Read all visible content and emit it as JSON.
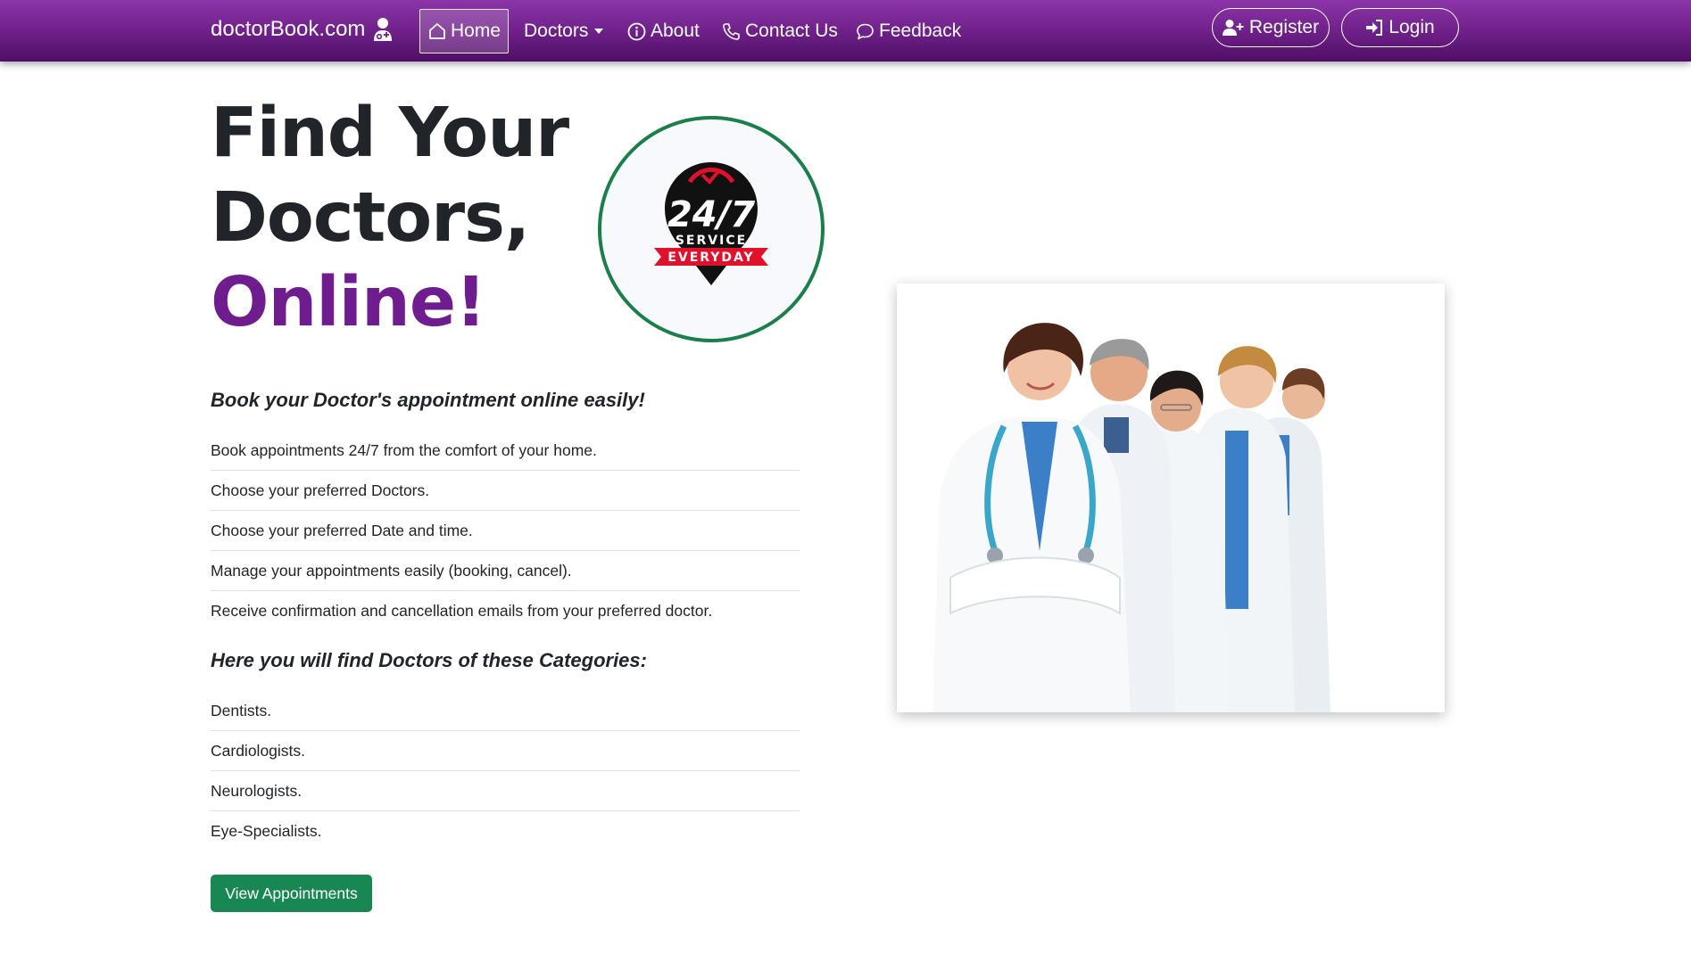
{
  "navbar": {
    "brand": "doctorBook.com",
    "brand_icon": "doctor-icon",
    "items": [
      {
        "label": "Home",
        "icon": "house-icon",
        "active": true
      },
      {
        "label": "Doctors",
        "icon": "caret-down-icon"
      },
      {
        "label": "About",
        "icon": "info-circle-icon"
      },
      {
        "label": "Contact Us",
        "icon": "phone-icon"
      },
      {
        "label": "Feedback",
        "icon": "chat-bubble-icon"
      }
    ],
    "register": {
      "label": "Register",
      "icon": "person-plus-icon"
    },
    "login": {
      "label": "Login",
      "icon": "login-arrow-icon"
    }
  },
  "hero": {
    "title_line1": "Find Your",
    "title_line2": "Doctors,",
    "title_accent": "Online!",
    "badge": {
      "number": "24/7",
      "line1": "SERVICE",
      "line2": "EVERYDAY"
    },
    "subtitle": "Book your Doctor's appointment online easily!",
    "features": [
      "Book appointments 24/7 from the comfort of your home.",
      "Choose your preferred Doctors.",
      "Choose your preferred Date and time.",
      "Manage your appointments easily (booking, cancel).",
      "Receive confirmation and cancellation emails from your preferred doctor."
    ],
    "categories_title": "Here you will find Doctors of these Categories:",
    "categories": [
      "Dentists.",
      "Cardiologists.",
      "Neurologists.",
      "Eye-Specialists."
    ],
    "cta_label": "View Appointments"
  },
  "colors": {
    "nav_purple": "#6d1f87",
    "accent_purple": "#6f1d8e",
    "success_green": "#198754",
    "badge_red": "#e0112b"
  }
}
